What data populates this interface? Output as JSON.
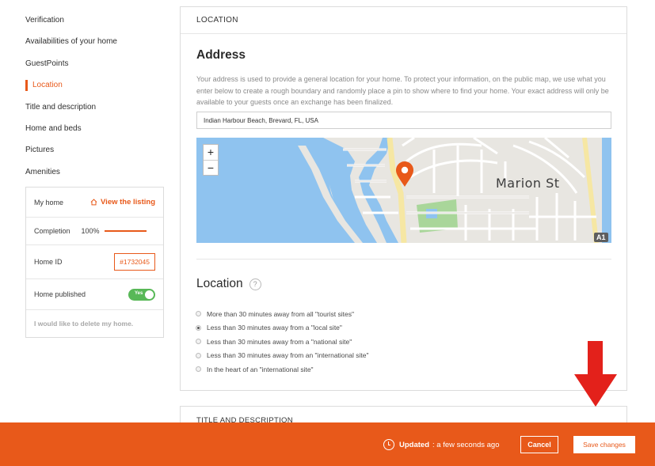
{
  "sidebar": {
    "items": [
      {
        "label": "Verification"
      },
      {
        "label": "Availabilities of your home"
      },
      {
        "label": "GuestPoints"
      },
      {
        "label": "Location"
      },
      {
        "label": "Title and description"
      },
      {
        "label": "Home and beds"
      },
      {
        "label": "Pictures"
      },
      {
        "label": "Amenities"
      }
    ],
    "active_item": "Location"
  },
  "my_home": {
    "title": "My home",
    "view_listing": "View the listing",
    "completion_label": "Completion",
    "completion_value": "100%",
    "completion_fraction": 1.0,
    "home_id_label": "Home ID",
    "home_id": "#1732045",
    "published_label": "Home published",
    "published_toggle": "Yes",
    "delete_link": "I would like to delete my home."
  },
  "location_section": {
    "header": "LOCATION",
    "address_title": "Address",
    "address_description": "Your address is used to provide a general location for your home. To protect your information, on the public map, we use what you enter below to create a rough boundary and randomly place a pin to show where to find your home. Your exact address will only be available to your guests once an exchange has been finalized.",
    "address_value": "Indian Harbour Beach, Brevard, FL, USA",
    "map": {
      "zoom_in": "+",
      "zoom_out": "−",
      "street_label": "Marion St",
      "road_badge": "A1"
    },
    "location_title": "Location",
    "help": "?",
    "options": [
      {
        "label": "More than 30 minutes away from all \"tourist sites\"",
        "checked": false
      },
      {
        "label": "Less than 30 minutes away from a \"local site\"",
        "checked": true
      },
      {
        "label": "Less than 30 minutes away from a \"national site\"",
        "checked": false
      },
      {
        "label": "Less than 30 minutes away from an \"international site\"",
        "checked": false
      },
      {
        "label": "In the heart of an \"international site\"",
        "checked": false
      }
    ]
  },
  "next_section": {
    "header": "TITLE AND DESCRIPTION"
  },
  "bottom_bar": {
    "updated_label": "Updated",
    "updated_time": ": a few seconds ago",
    "cancel_label": "Cancel",
    "save_label": "Save changes"
  },
  "colors": {
    "accent": "#e8591a",
    "toggle_on": "#58b857",
    "arrow": "#e3211b",
    "map_water": "#8fc3ef",
    "map_park": "#a9d69a"
  }
}
